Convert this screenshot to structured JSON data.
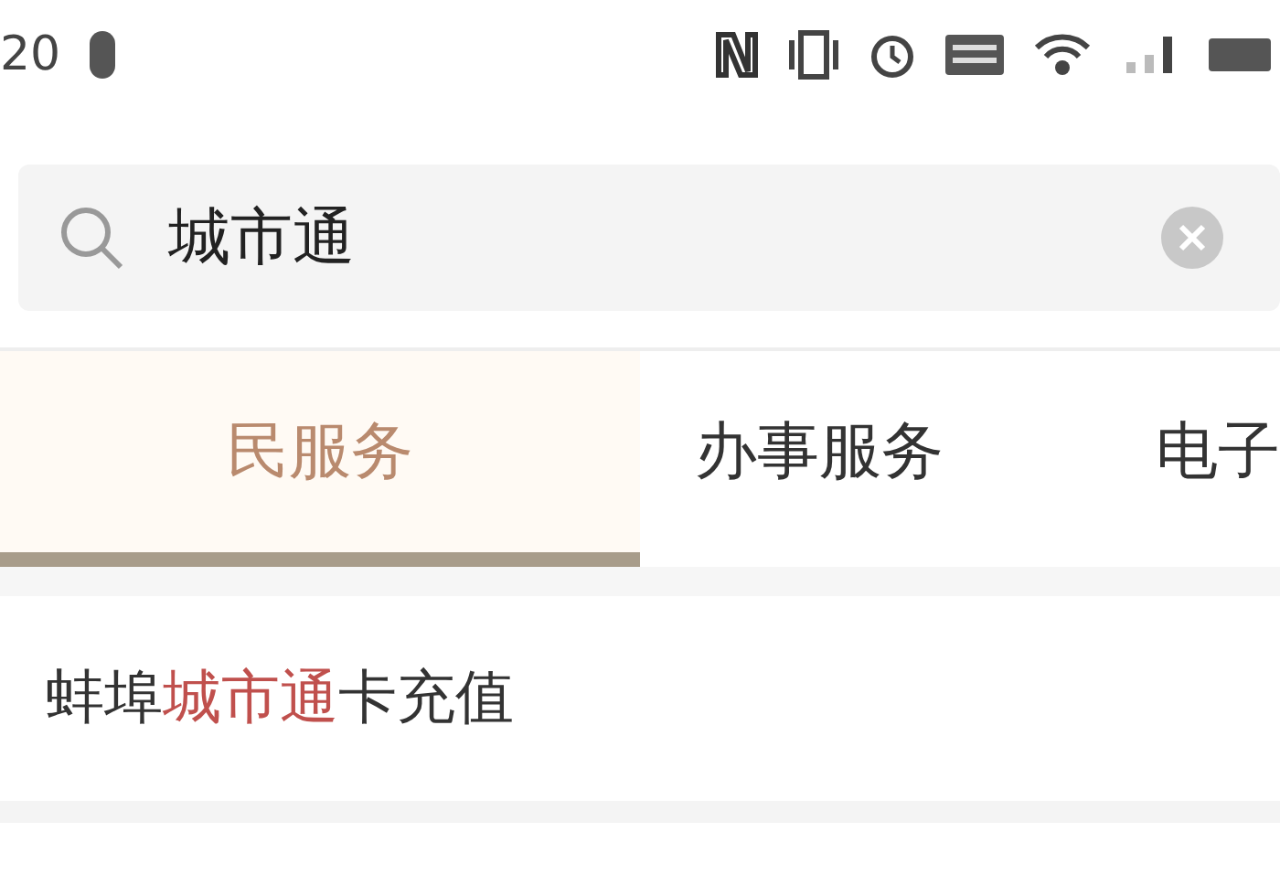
{
  "status_bar": {
    "time": "20"
  },
  "search": {
    "value": "城市通"
  },
  "tabs": [
    {
      "label": "民服务",
      "selected": true
    },
    {
      "label": "办事服务",
      "selected": false
    },
    {
      "label": "电子",
      "selected": false
    }
  ],
  "results": [
    {
      "parts": [
        {
          "text": "蚌埠",
          "highlighted": false
        },
        {
          "text": "城市通",
          "highlighted": true
        },
        {
          "text": "卡充值",
          "highlighted": false
        }
      ]
    }
  ]
}
